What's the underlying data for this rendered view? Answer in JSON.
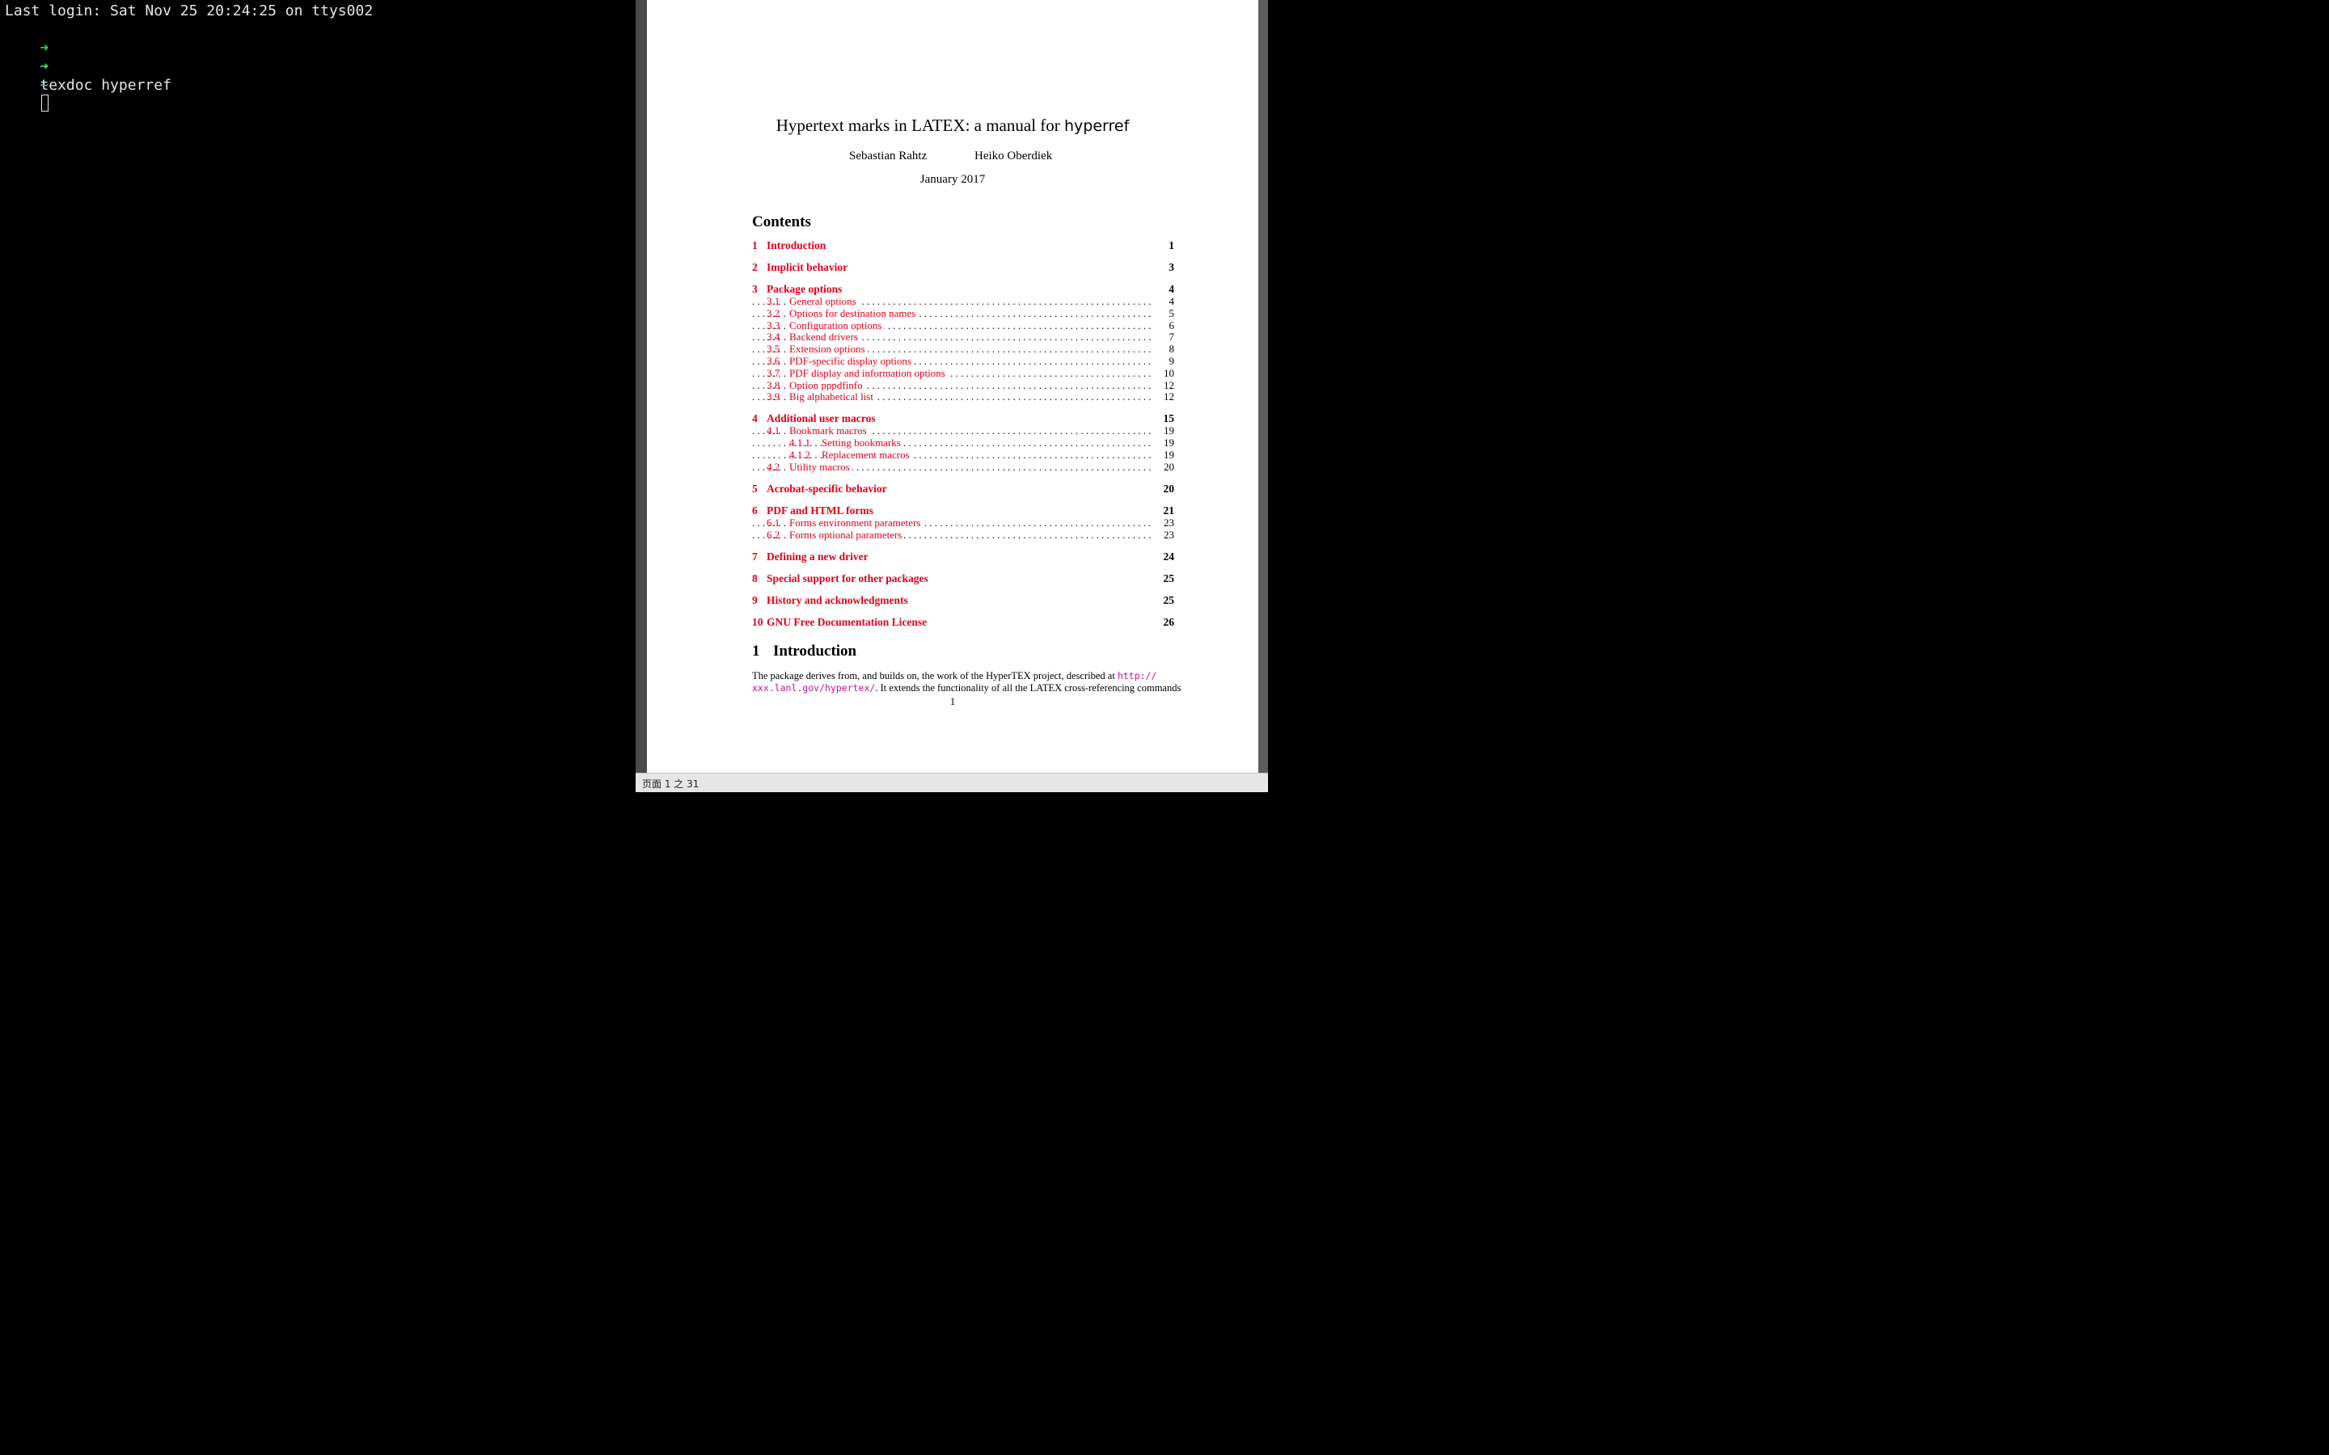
{
  "terminal": {
    "last_login": "Last login: Sat Nov 25 20:24:25 on ttys002",
    "prompt_arrow": "➜",
    "prompt_tilde": "~",
    "command": "texdoc hyperref"
  },
  "document": {
    "title_pre": "Hypertext marks in ",
    "title_latex": "LATEX",
    "title_mid": ": a manual for ",
    "title_pkg": "hyperref",
    "author1": "Sebastian Rahtz",
    "author2": "Heiko Oberdiek",
    "date": "January 2017",
    "contents_heading": "Contents",
    "toc": [
      {
        "num": "1",
        "title": "Introduction",
        "page": "1",
        "level": 0
      },
      {
        "num": "2",
        "title": "Implicit behavior",
        "page": "3",
        "level": 0
      },
      {
        "num": "3",
        "title": "Package options",
        "page": "4",
        "level": 0
      },
      {
        "num": "3.1",
        "title": "General options",
        "page": "4",
        "level": 1
      },
      {
        "num": "3.2",
        "title": "Options for destination names",
        "page": "5",
        "level": 1
      },
      {
        "num": "3.3",
        "title": "Configuration options",
        "page": "6",
        "level": 1
      },
      {
        "num": "3.4",
        "title": "Backend drivers",
        "page": "7",
        "level": 1
      },
      {
        "num": "3.5",
        "title": "Extension options",
        "page": "8",
        "level": 1
      },
      {
        "num": "3.6",
        "title": "PDF-specific display options",
        "page": "9",
        "level": 1
      },
      {
        "num": "3.7",
        "title": "PDF display and information options",
        "page": "10",
        "level": 1
      },
      {
        "num": "3.8",
        "title": "Option pppdfinfo",
        "page": "12",
        "level": 1
      },
      {
        "num": "3.9",
        "title": "Big alphabetical list",
        "page": "12",
        "level": 1
      },
      {
        "num": "4",
        "title": "Additional user macros",
        "page": "15",
        "level": 0
      },
      {
        "num": "4.1",
        "title": "Bookmark macros",
        "page": "19",
        "level": 1
      },
      {
        "num": "4.1.1",
        "title": "Setting bookmarks",
        "page": "19",
        "level": 2
      },
      {
        "num": "4.1.2",
        "title": "Replacement macros",
        "page": "19",
        "level": 2
      },
      {
        "num": "4.2",
        "title": "Utility macros",
        "page": "20",
        "level": 1
      },
      {
        "num": "5",
        "title": "Acrobat-specific behavior",
        "page": "20",
        "level": 0
      },
      {
        "num": "6",
        "title": "PDF and HTML forms",
        "page": "21",
        "level": 0
      },
      {
        "num": "6.1",
        "title": "Forms environment parameters",
        "page": "23",
        "level": 1
      },
      {
        "num": "6.2",
        "title": "Forms optional parameters",
        "page": "23",
        "level": 1
      },
      {
        "num": "7",
        "title": "Defining a new driver",
        "page": "24",
        "level": 0
      },
      {
        "num": "8",
        "title": "Special support for other packages",
        "page": "25",
        "level": 0
      },
      {
        "num": "9",
        "title": "History and acknowledgments",
        "page": "25",
        "level": 0
      },
      {
        "num": "10",
        "title": "GNU Free Documentation License",
        "page": "26",
        "level": 0
      }
    ],
    "intro_num": "1",
    "intro_title": "Introduction",
    "intro_line1": "The package derives from, and builds on, the work of the HyperTEX project, described at ",
    "intro_url1": "http://",
    "intro_url2": "xxx.lanl.gov/hypertex/",
    "intro_line2": ". It extends the functionality of all the LATEX cross-referencing commands",
    "page_number": "1"
  },
  "statusbar": {
    "text": "页面 1 之 31"
  },
  "colors": {
    "link_red": "#e0001b",
    "url_magenta": "#c2178a",
    "prompt_green": "#39d353",
    "prompt_cyan": "#5ec7d8"
  }
}
